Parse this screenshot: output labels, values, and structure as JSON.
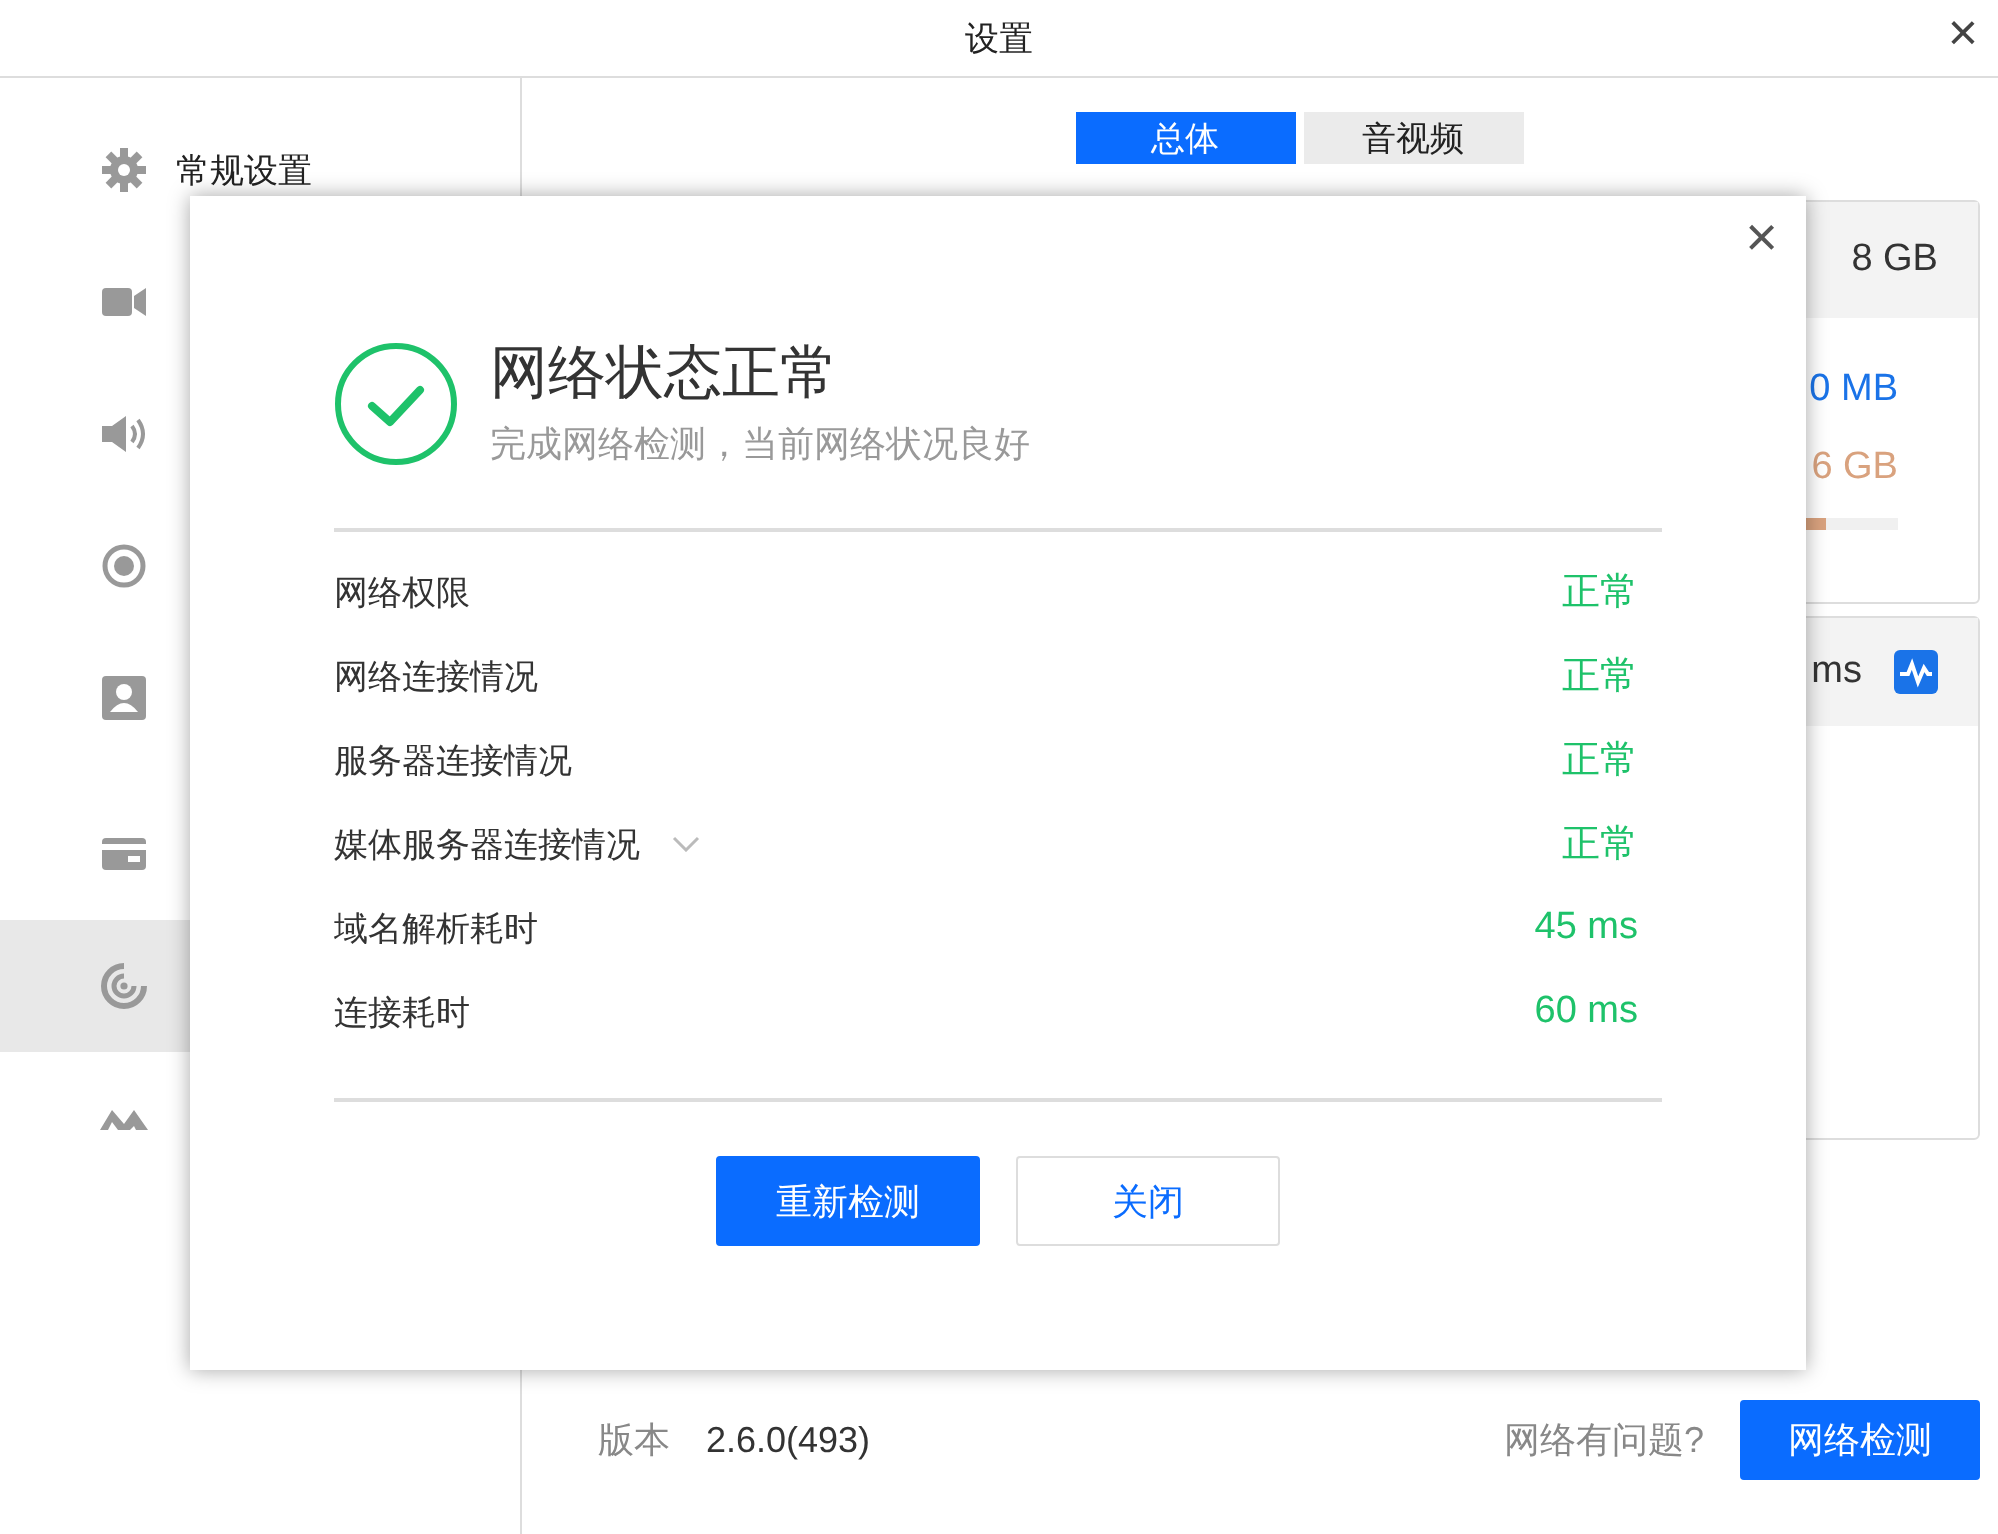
{
  "window": {
    "title": "设置",
    "close": "×"
  },
  "sidebar": {
    "items": [
      {
        "kind": "gear",
        "label": "常规设置",
        "selected": false
      },
      {
        "kind": "camera",
        "selected": false
      },
      {
        "kind": "speaker",
        "selected": false
      },
      {
        "kind": "record",
        "selected": false
      },
      {
        "kind": "contact",
        "selected": false
      },
      {
        "kind": "card",
        "selected": false
      },
      {
        "kind": "gauge",
        "selected": true
      },
      {
        "kind": "logo",
        "selected": false
      }
    ]
  },
  "tabs": [
    {
      "label": "总体",
      "selected": true
    },
    {
      "label": "音视频",
      "selected": false
    }
  ],
  "cards": [
    {
      "header": "8 GB",
      "kind": "usage",
      "rows": [
        {
          "text": "0 MB",
          "color": "#1a73e8"
        },
        {
          "text": "6 GB",
          "color": "#d9a27e"
        }
      ],
      "level": 0.4
    },
    {
      "header": "ms",
      "kind": "latency"
    }
  ],
  "footer": {
    "version_label": "版本",
    "version": "2.6.0(493)",
    "question": "网络有问题?",
    "button": "网络检测"
  },
  "dialog": {
    "close": "×",
    "title": "网络状态正常",
    "subtitle": "完成网络检测，当前网络状况良好",
    "rows": [
      {
        "label": "网络权限",
        "value": "正常",
        "expandable": false
      },
      {
        "label": "网络连接情况",
        "value": "正常",
        "expandable": false
      },
      {
        "label": "服务器连接情况",
        "value": "正常",
        "expandable": false
      },
      {
        "label": "媒体服务器连接情况",
        "value": "正常",
        "expandable": true
      },
      {
        "label": "域名解析耗时",
        "value": "45 ms",
        "expandable": false
      },
      {
        "label": "连接耗时",
        "value": "60 ms",
        "expandable": false
      }
    ],
    "buttons": [
      {
        "label": "重新检测",
        "kind": "primary"
      },
      {
        "label": "关闭",
        "kind": "secondary"
      }
    ]
  }
}
